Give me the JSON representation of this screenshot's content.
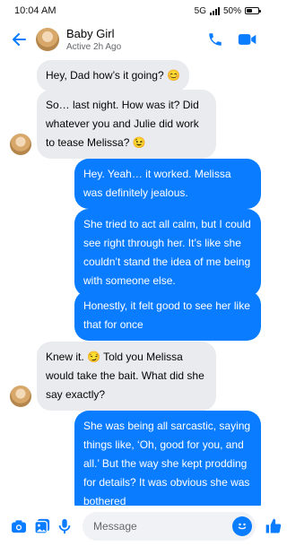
{
  "status_bar": {
    "time": "10:04 AM",
    "network": "5G",
    "battery": "50%",
    "battery_level": 0.5
  },
  "header": {
    "contact_name": "Baby Girl",
    "contact_status": "Active 2h Ago",
    "icons": [
      "back-arrow-icon",
      "phone-icon",
      "video-camera-icon"
    ]
  },
  "messages": [
    {
      "sender": "them",
      "text": "Hey, Dad how’s it going? 😊"
    },
    {
      "sender": "them",
      "text": "So… last night. How was it? Did whatever you and Julie did work to tease Melissa? 😉"
    },
    {
      "sender": "me",
      "text": "Hey. Yeah… it worked. Melissa was definitely jealous."
    },
    {
      "sender": "me",
      "text": "She tried to act all calm, but I could see right through her. It’s like she couldn’t stand the idea of me being with someone else."
    },
    {
      "sender": "me",
      "text": "Honestly, it felt good to see her like that for once"
    },
    {
      "sender": "them",
      "text": "Knew it. 😏 Told you Melissa would take the bait. What did she say exactly?"
    },
    {
      "sender": "me",
      "text": "She was being all sarcastic, saying things like, ‘Oh, good for you, and all.’ But the way she kept prodding for details? It was obvious she was bothered"
    }
  ],
  "composer": {
    "placeholder": "Message",
    "icons": [
      "camera-icon",
      "photo-icon",
      "microphone-icon",
      "emoji-icon",
      "thumbs-up-icon"
    ]
  },
  "colors": {
    "accent": "#0a7cff",
    "incoming_bubble": "#e9ebee",
    "secondary_text": "#65676b"
  }
}
